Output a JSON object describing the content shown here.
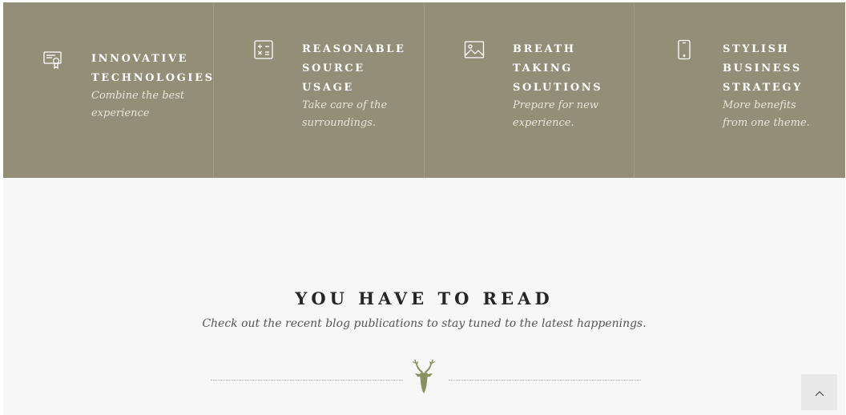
{
  "features": [
    {
      "icon": "certificate-icon",
      "title": [
        "INNOVATIVE",
        "TECHNOLOGIES"
      ],
      "desc": [
        "Combine the best",
        "experience"
      ]
    },
    {
      "icon": "calculator-icon",
      "title": [
        "REASONABLE",
        "SOURCE",
        "USAGE"
      ],
      "desc": [
        "Take care of the",
        "surroundings."
      ]
    },
    {
      "icon": "image-icon",
      "title": [
        "BREATH",
        "TAKING",
        "SOLUTIONS"
      ],
      "desc": [
        "Prepare for new",
        "experience."
      ]
    },
    {
      "icon": "phone-icon",
      "title": [
        "STYLISH",
        "BUSINESS",
        "STRATEGY"
      ],
      "desc": [
        "More benefits",
        "from one theme."
      ]
    }
  ],
  "section": {
    "title": "YOU HAVE TO READ",
    "subtitle": "Check out the recent blog publications to stay tuned to the latest happenings.",
    "divider_icon": "deer-head-icon"
  },
  "back_to_top": {
    "icon": "chevron-up-icon"
  },
  "colors": {
    "feature_bg": "#938e77",
    "section_bg": "#f7f7f7",
    "accent_deer": "#8a9060"
  }
}
